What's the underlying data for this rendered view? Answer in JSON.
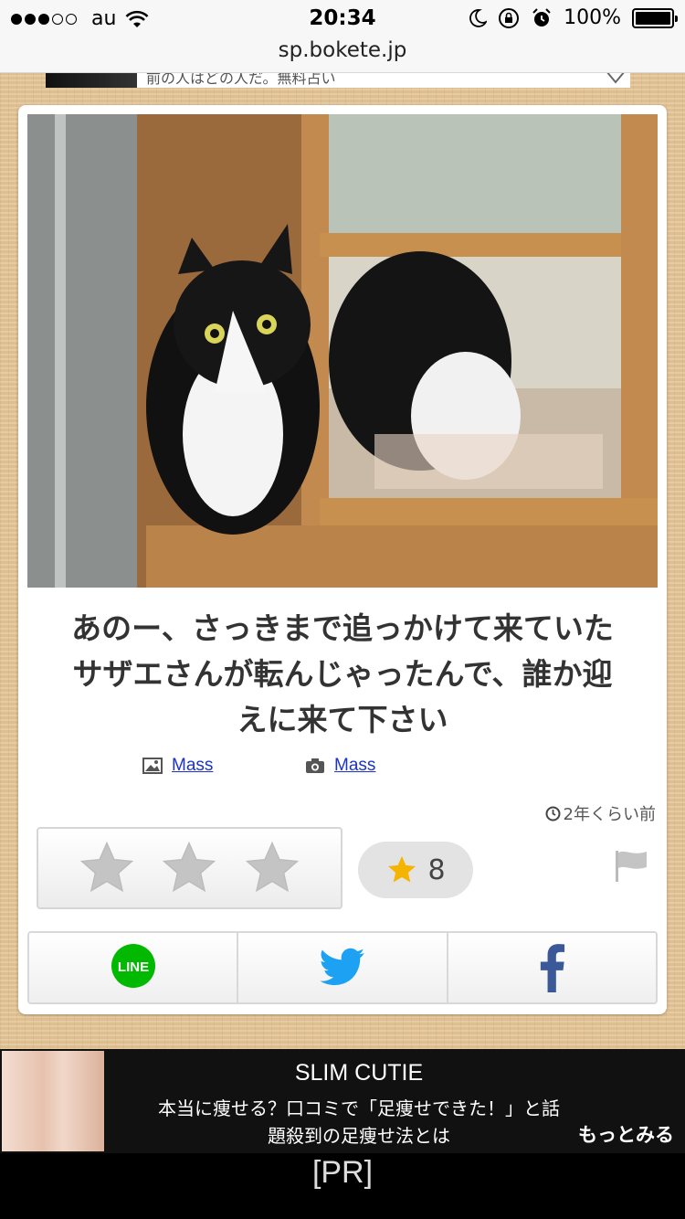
{
  "status_bar": {
    "carrier": "au",
    "time": "20:34",
    "battery": "100%"
  },
  "browser": {
    "url": "sp.bokete.jp"
  },
  "top_ad": {
    "text": "前の人はどの人だ。無料占い"
  },
  "post": {
    "caption_lines": [
      "あのー、さっきまで追っかけて来ていた",
      "サザエさんが転んじゃったんで、誰か迎",
      "えに来て下さい"
    ],
    "image_credit": "Mass",
    "author": "Mass",
    "time_ago": "2年くらい前",
    "star_count": "8",
    "star_color": "#f5b400"
  },
  "share": {
    "line_label": "LINE",
    "line_color": "#00b900",
    "twitter_color": "#1da1f2",
    "facebook_color": "#3b5998"
  },
  "bottom_ad": {
    "title": "SLIM CUTIE",
    "desc_line1": "本当に痩せる？口コミで「足痩せできた！」と話",
    "desc_line2": "題殺到の足痩せ法とは",
    "more": "もっとみる",
    "pr": "[PR]"
  }
}
